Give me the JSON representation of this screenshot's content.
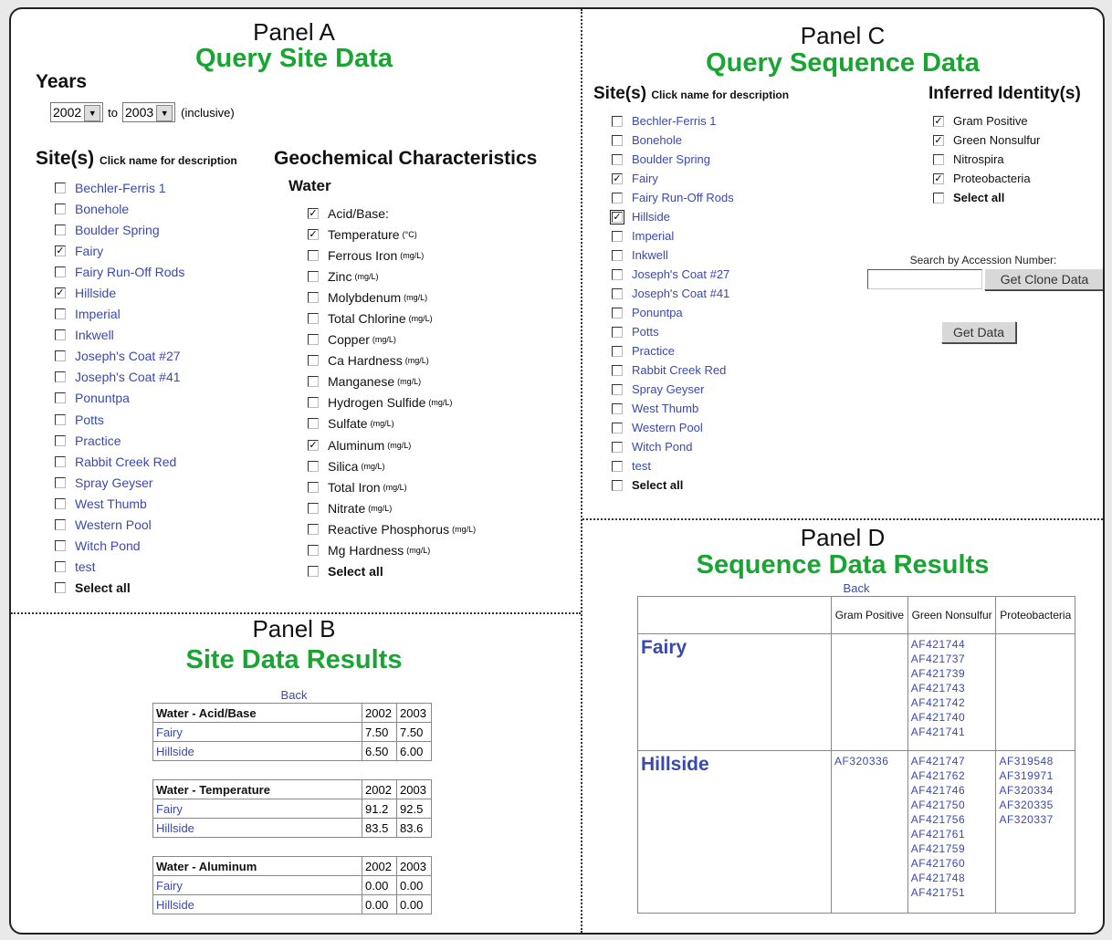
{
  "panelA": {
    "name": "Panel A",
    "title": "Query Site Data",
    "years_label": "Years",
    "year_from": "2002",
    "to_label": "to",
    "year_to": "2003",
    "inclusive": "(inclusive)",
    "sites_heading": "Site(s)",
    "sites_hint": "Click name for description",
    "geo_heading": "Geochemical Characteristics",
    "water_label": "Water",
    "sites": [
      {
        "label": "Bechler-Ferris 1",
        "checked": false
      },
      {
        "label": "Bonehole",
        "checked": false
      },
      {
        "label": "Boulder Spring",
        "checked": false
      },
      {
        "label": "Fairy",
        "checked": true
      },
      {
        "label": "Fairy Run-Off Rods",
        "checked": false
      },
      {
        "label": "Hillside",
        "checked": true
      },
      {
        "label": "Imperial",
        "checked": false
      },
      {
        "label": "Inkwell",
        "checked": false
      },
      {
        "label": "Joseph's Coat #27",
        "checked": false
      },
      {
        "label": "Joseph's Coat #41",
        "checked": false
      },
      {
        "label": "Ponuntpa",
        "checked": false
      },
      {
        "label": "Potts",
        "checked": false
      },
      {
        "label": "Practice",
        "checked": false
      },
      {
        "label": "Rabbit Creek Red",
        "checked": false
      },
      {
        "label": "Spray Geyser",
        "checked": false
      },
      {
        "label": "West Thumb",
        "checked": false
      },
      {
        "label": "Western Pool",
        "checked": false
      },
      {
        "label": "Witch Pond",
        "checked": false
      },
      {
        "label": "test",
        "checked": false
      }
    ],
    "select_all": "Select all",
    "water_params": [
      {
        "label": "Acid/Base:",
        "unit": "",
        "checked": true
      },
      {
        "label": "Temperature",
        "unit": "(°C)",
        "checked": true
      },
      {
        "label": "Ferrous Iron",
        "unit": "(mg/L)",
        "checked": false
      },
      {
        "label": "Zinc",
        "unit": "(mg/L)",
        "checked": false
      },
      {
        "label": "Molybdenum",
        "unit": "(mg/L)",
        "checked": false
      },
      {
        "label": "Total Chlorine",
        "unit": "(mg/L)",
        "checked": false
      },
      {
        "label": "Copper",
        "unit": "(mg/L)",
        "checked": false
      },
      {
        "label": "Ca Hardness",
        "unit": "(mg/L)",
        "checked": false
      },
      {
        "label": "Manganese",
        "unit": "(mg/L)",
        "checked": false
      },
      {
        "label": "Hydrogen Sulfide",
        "unit": "(mg/L)",
        "checked": false
      },
      {
        "label": "Sulfate",
        "unit": "(mg/L)",
        "checked": false
      },
      {
        "label": "Aluminum",
        "unit": "(mg/L)",
        "checked": true
      },
      {
        "label": "Silica",
        "unit": "(mg/L)",
        "checked": false
      },
      {
        "label": "Total Iron",
        "unit": "(mg/L)",
        "checked": false
      },
      {
        "label": "Nitrate",
        "unit": "(mg/L)",
        "checked": false
      },
      {
        "label": "Reactive Phosphorus",
        "unit": "(mg/L)",
        "checked": false
      },
      {
        "label": "Mg Hardness",
        "unit": "(mg/L)",
        "checked": false
      }
    ]
  },
  "panelB": {
    "name": "Panel B",
    "title": "Site Data Results",
    "back": "Back",
    "tables": [
      {
        "header": "Water - Acid/Base",
        "years": [
          "2002",
          "2003"
        ],
        "rows": [
          {
            "site": "Fairy",
            "v": [
              "7.50",
              "7.50"
            ]
          },
          {
            "site": "Hillside",
            "v": [
              "6.50",
              "6.00"
            ]
          }
        ]
      },
      {
        "header": "Water - Temperature",
        "years": [
          "2002",
          "2003"
        ],
        "rows": [
          {
            "site": "Fairy",
            "v": [
              "91.2",
              "92.5"
            ]
          },
          {
            "site": "Hillside",
            "v": [
              "83.5",
              "83.6"
            ]
          }
        ]
      },
      {
        "header": "Water - Aluminum",
        "years": [
          "2002",
          "2003"
        ],
        "rows": [
          {
            "site": "Fairy",
            "v": [
              "0.00",
              "0.00"
            ]
          },
          {
            "site": "Hillside",
            "v": [
              "0.00",
              "0.00"
            ]
          }
        ]
      }
    ]
  },
  "panelC": {
    "name": "Panel C",
    "title": "Query Sequence Data",
    "sites_heading": "Site(s)",
    "sites_hint": "Click name for description",
    "identity_heading": "Inferred Identity(s)",
    "sites": [
      {
        "label": "Bechler-Ferris 1",
        "checked": false
      },
      {
        "label": "Bonehole",
        "checked": false
      },
      {
        "label": "Boulder Spring",
        "checked": false
      },
      {
        "label": "Fairy",
        "checked": true
      },
      {
        "label": "Fairy Run-Off Rods",
        "checked": false
      },
      {
        "label": "Hillside",
        "checked": true
      },
      {
        "label": "Imperial",
        "checked": false
      },
      {
        "label": "Inkwell",
        "checked": false
      },
      {
        "label": "Joseph's Coat #27",
        "checked": false
      },
      {
        "label": "Joseph's Coat #41",
        "checked": false
      },
      {
        "label": "Ponuntpa",
        "checked": false
      },
      {
        "label": "Potts",
        "checked": false
      },
      {
        "label": "Practice",
        "checked": false
      },
      {
        "label": "Rabbit Creek Red",
        "checked": false
      },
      {
        "label": "Spray Geyser",
        "checked": false
      },
      {
        "label": "West Thumb",
        "checked": false
      },
      {
        "label": "Western Pool",
        "checked": false
      },
      {
        "label": "Witch Pond",
        "checked": false
      },
      {
        "label": "test",
        "checked": false
      }
    ],
    "select_all": "Select all",
    "identities": [
      {
        "label": "Gram Positive",
        "checked": true
      },
      {
        "label": "Green Nonsulfur",
        "checked": true
      },
      {
        "label": "Nitrospira",
        "checked": false
      },
      {
        "label": "Proteobacteria",
        "checked": true
      }
    ],
    "identity_select_all": "Select all",
    "accession_label": "Search by Accession Number:",
    "accession_value": "",
    "clone_button": "Get Clone Data",
    "get_data_button": "Get Data"
  },
  "panelD": {
    "name": "Panel D",
    "title": "Sequence Data Results",
    "back": "Back",
    "columns": [
      "Gram Positive",
      "Green Nonsulfur",
      "Proteobacteria"
    ],
    "rows": [
      {
        "site": "Fairy",
        "gram_positive": [],
        "green_nonsulfur": [
          "AF421744",
          "AF421737",
          "AF421739",
          "AF421743",
          "AF421742",
          "AF421740",
          "AF421741"
        ],
        "proteobacteria": []
      },
      {
        "site": "Hillside",
        "gram_positive": [
          "AF320336"
        ],
        "green_nonsulfur": [
          "AF421747",
          "AF421762",
          "AF421746",
          "AF421750",
          "AF421756",
          "AF421761",
          "AF421759",
          "AF421760",
          "AF421748",
          "AF421751"
        ],
        "proteobacteria": [
          "AF319548",
          "AF319971",
          "AF320334",
          "AF320335",
          "AF320337"
        ]
      }
    ]
  }
}
